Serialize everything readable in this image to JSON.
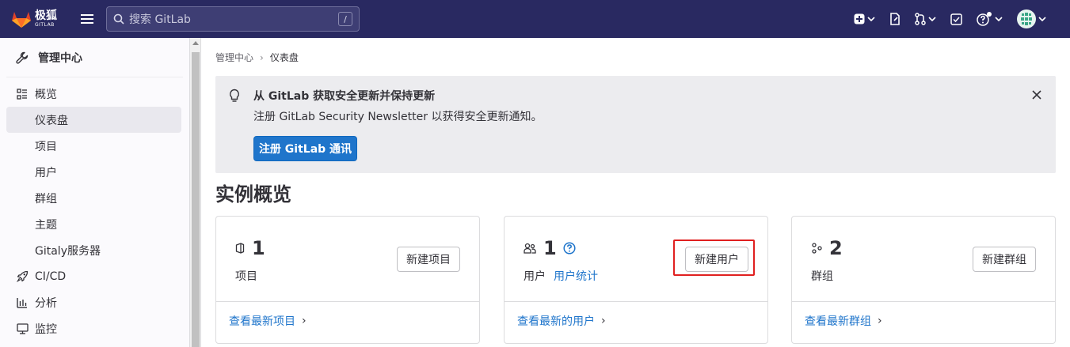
{
  "topbar": {
    "logo_text": "极狐",
    "logo_subtext": "GITLAB",
    "search_placeholder": "搜索 GitLab",
    "search_shortcut": "/",
    "icons": [
      "plus-square-icon",
      "merge-request-icon",
      "todo-icon",
      "help-icon",
      "avatar"
    ]
  },
  "sidebar": {
    "header": "管理中心",
    "items": [
      {
        "label": "概览",
        "icon": "overview-icon",
        "level": 0
      },
      {
        "label": "仪表盘",
        "level": 1,
        "active": true
      },
      {
        "label": "项目",
        "level": 1
      },
      {
        "label": "用户",
        "level": 1
      },
      {
        "label": "群组",
        "level": 1
      },
      {
        "label": "主题",
        "level": 1
      },
      {
        "label": "Gitaly服务器",
        "level": 1
      },
      {
        "label": "CI/CD",
        "icon": "rocket-icon",
        "level": 0
      },
      {
        "label": "分析",
        "icon": "chart-icon",
        "level": 0
      },
      {
        "label": "监控",
        "icon": "monitor-icon",
        "level": 0
      }
    ]
  },
  "breadcrumb": {
    "parent": "管理中心",
    "separator": "›",
    "current": "仪表盘"
  },
  "alert": {
    "title": "从 GitLab 获取安全更新并保持更新",
    "body": "注册 GitLab Security Newsletter 以获得安全更新通知。",
    "button": "注册 GitLab 通讯"
  },
  "page_title": "实例概览",
  "cards": {
    "projects": {
      "count": "1",
      "label": "项目",
      "button": "新建项目",
      "footer": "查看最新项目",
      "chevron": "›"
    },
    "users": {
      "count": "1",
      "label": "用户",
      "link": "用户统计",
      "button": "新建用户",
      "footer": "查看最新的用户",
      "chevron": "›"
    },
    "groups": {
      "count": "2",
      "label": "群组",
      "button": "新建群组",
      "footer": "查看最新群组",
      "chevron": "›"
    }
  },
  "colors": {
    "topbar": "#292961",
    "primary": "#1f75cb",
    "highlight": "#e02020"
  }
}
